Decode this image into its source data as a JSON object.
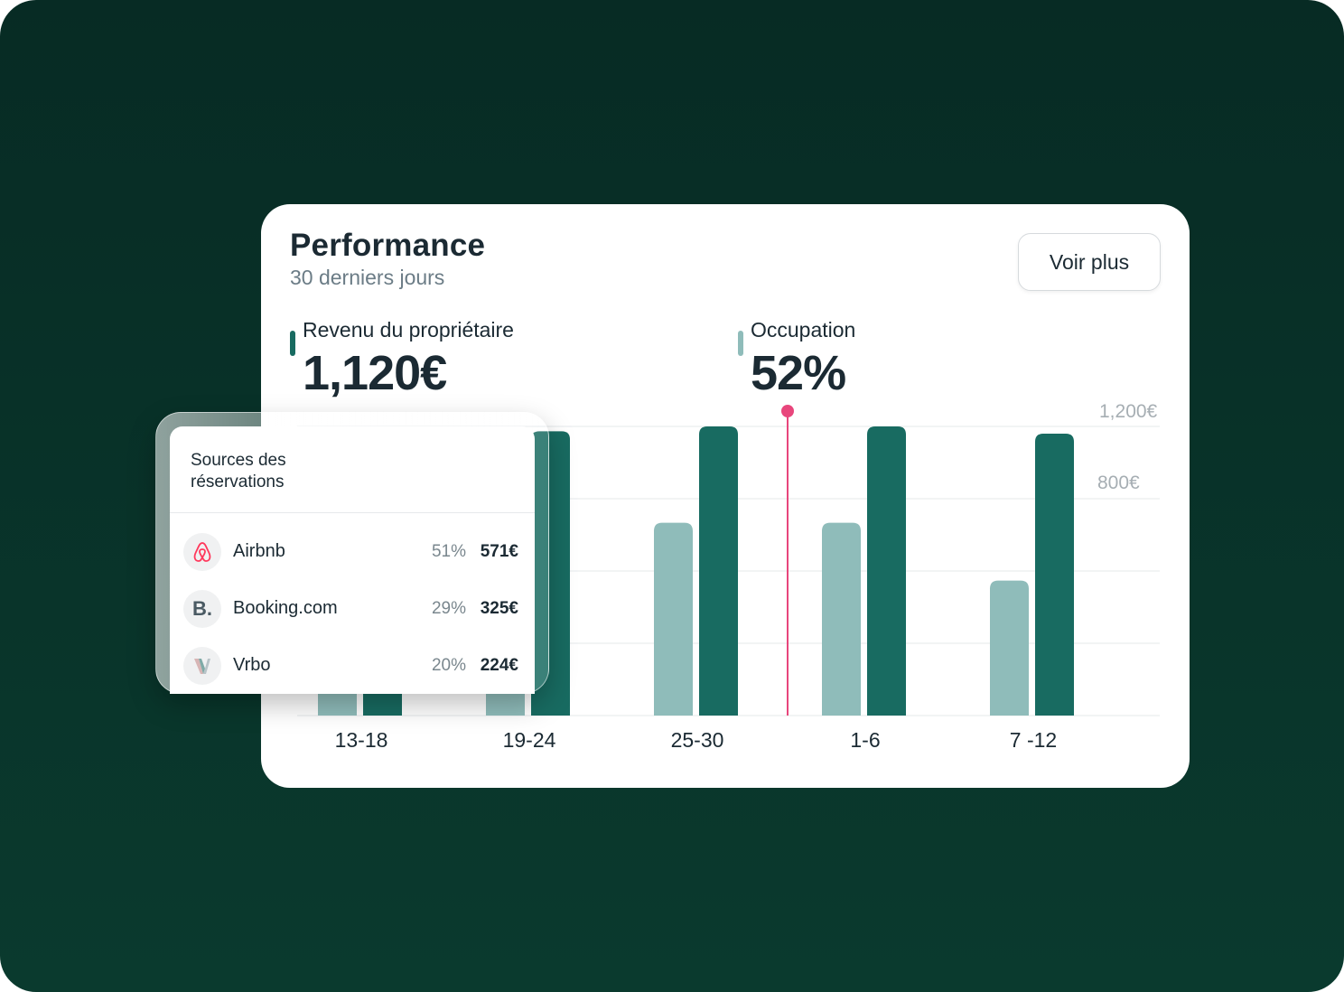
{
  "card": {
    "title": "Performance",
    "subtitle": "30 derniers jours",
    "voir_plus": "Voir plus"
  },
  "metrics": {
    "revenue": {
      "label": "Revenu du propriétaire",
      "value": "1,120€",
      "color": "#186b61"
    },
    "occupancy": {
      "label": "Occupation",
      "value": "52%",
      "color": "#8fbcba"
    }
  },
  "chart_data": {
    "type": "bar",
    "categories": [
      "13-18",
      "19-24",
      "25-30",
      "1-6",
      "7 -12"
    ],
    "y_tick_labels": [
      "1,200€",
      "800€"
    ],
    "series": [
      {
        "values": [
          320,
          560,
          800,
          800,
          560
        ],
        "color": "#8fbcba"
      },
      {
        "values": [
          1000,
          1180,
          1200,
          1200,
          1170
        ],
        "color": "#186b61"
      }
    ],
    "marker_color": "#e8467c",
    "grid": true,
    "note": "bar heights are estimates"
  },
  "sources": {
    "title": "Sources des réservations",
    "items": [
      {
        "name": "Airbnb",
        "pct": "51%",
        "amount": "571€",
        "icon": "airbnb-icon",
        "icon_color": "#ff385c"
      },
      {
        "name": "Booking.com",
        "pct": "29%",
        "amount": "325€",
        "icon": "booking-icon",
        "icon_text": "B."
      },
      {
        "name": "Vrbo",
        "pct": "20%",
        "amount": "224€",
        "icon": "vrbo-icon"
      }
    ]
  }
}
